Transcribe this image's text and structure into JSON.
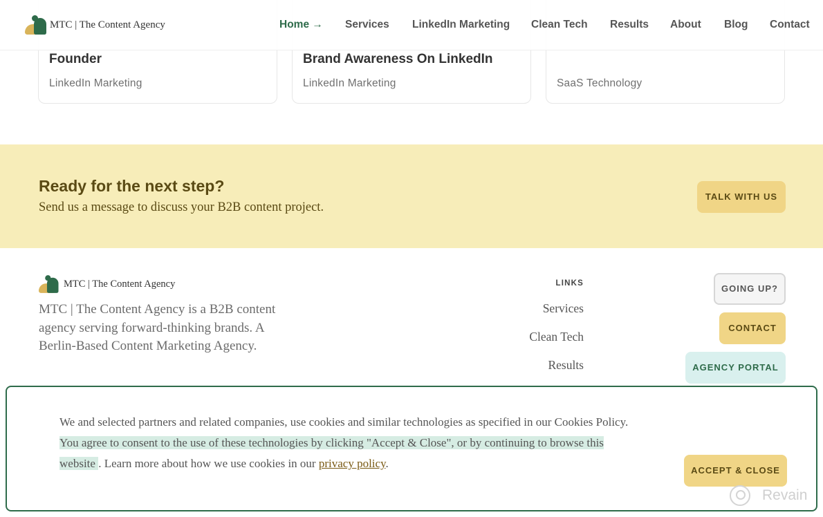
{
  "brand": {
    "name": "MTC | The Content Agency"
  },
  "nav": {
    "items": [
      {
        "label": "Home →",
        "active": true
      },
      {
        "label": "Services"
      },
      {
        "label": "LinkedIn Marketing"
      },
      {
        "label": "Clean Tech"
      },
      {
        "label": "Results"
      },
      {
        "label": "About"
      },
      {
        "label": "Blog"
      },
      {
        "label": "Contact"
      }
    ]
  },
  "cards": [
    {
      "title": "Founder",
      "category": "LinkedIn Marketing"
    },
    {
      "title": "Brand Awareness On LinkedIn",
      "category": "LinkedIn Marketing"
    },
    {
      "title": "",
      "category": "SaaS Technology"
    }
  ],
  "cta": {
    "title": "Ready for the next step?",
    "subtitle": "Send us a message to discuss your B2B content project.",
    "button": "TALK WITH US"
  },
  "footer": {
    "brand": "MTC | The Content Agency",
    "description": "MTC | The Content Agency is a B2B content agency serving forward-thinking brands. A Berlin-Based Content Marketing Agency.",
    "links_heading": "LINKS",
    "links": [
      "Services",
      "Clean Tech",
      "Results"
    ],
    "buttons": {
      "going_up": "GOING UP?",
      "contact": "CONTACT",
      "portal": "AGENCY PORTAL"
    }
  },
  "cookie": {
    "text_start": "We and selected partners and related companies, use cookies and similar technologies as specified in our Cookies Policy. ",
    "text_highlight": "You agree to consent to the use of these technologies by clicking \"Accept & Close\", or by continuing to browse this website ",
    "text_mid": ". Learn more about how we use cookies in our ",
    "link": "privacy policy",
    "text_end": ".",
    "button": "ACCEPT & CLOSE"
  },
  "watermark": "Revain",
  "colors": {
    "accent_green": "#2e6b4a",
    "accent_yellow": "#f0d586",
    "cta_band": "#f7edb9",
    "portal_mint": "#d9f0ee"
  }
}
